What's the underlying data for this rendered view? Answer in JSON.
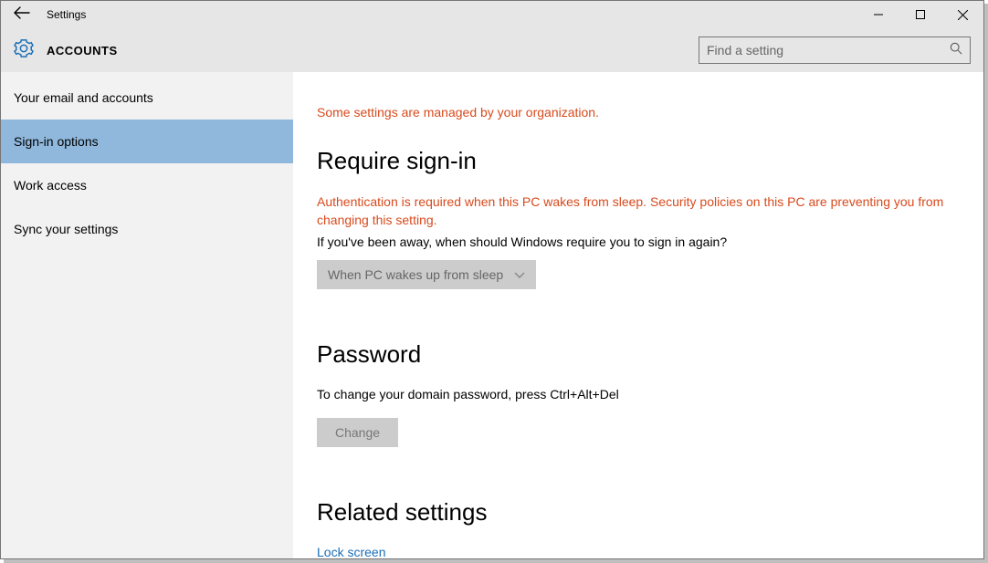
{
  "window": {
    "title": "Settings"
  },
  "header": {
    "section": "ACCOUNTS",
    "search_placeholder": "Find a setting"
  },
  "sidebar": {
    "items": [
      {
        "label": "Your email and accounts"
      },
      {
        "label": "Sign-in options"
      },
      {
        "label": "Work access"
      },
      {
        "label": "Sync your settings"
      }
    ]
  },
  "main": {
    "org_message": "Some settings are managed by your organization.",
    "require_signin_heading": "Require sign-in",
    "auth_warning": "Authentication is required when this PC wakes from sleep. Security policies on this PC are preventing you from changing this setting.",
    "signin_desc": "If you've been away, when should Windows require you to sign in again?",
    "dropdown_value": "When PC wakes up from sleep",
    "password_heading": "Password",
    "password_desc": "To change your domain password, press Ctrl+Alt+Del",
    "change_button": "Change",
    "related_heading": "Related settings",
    "lock_screen_link": "Lock screen"
  }
}
